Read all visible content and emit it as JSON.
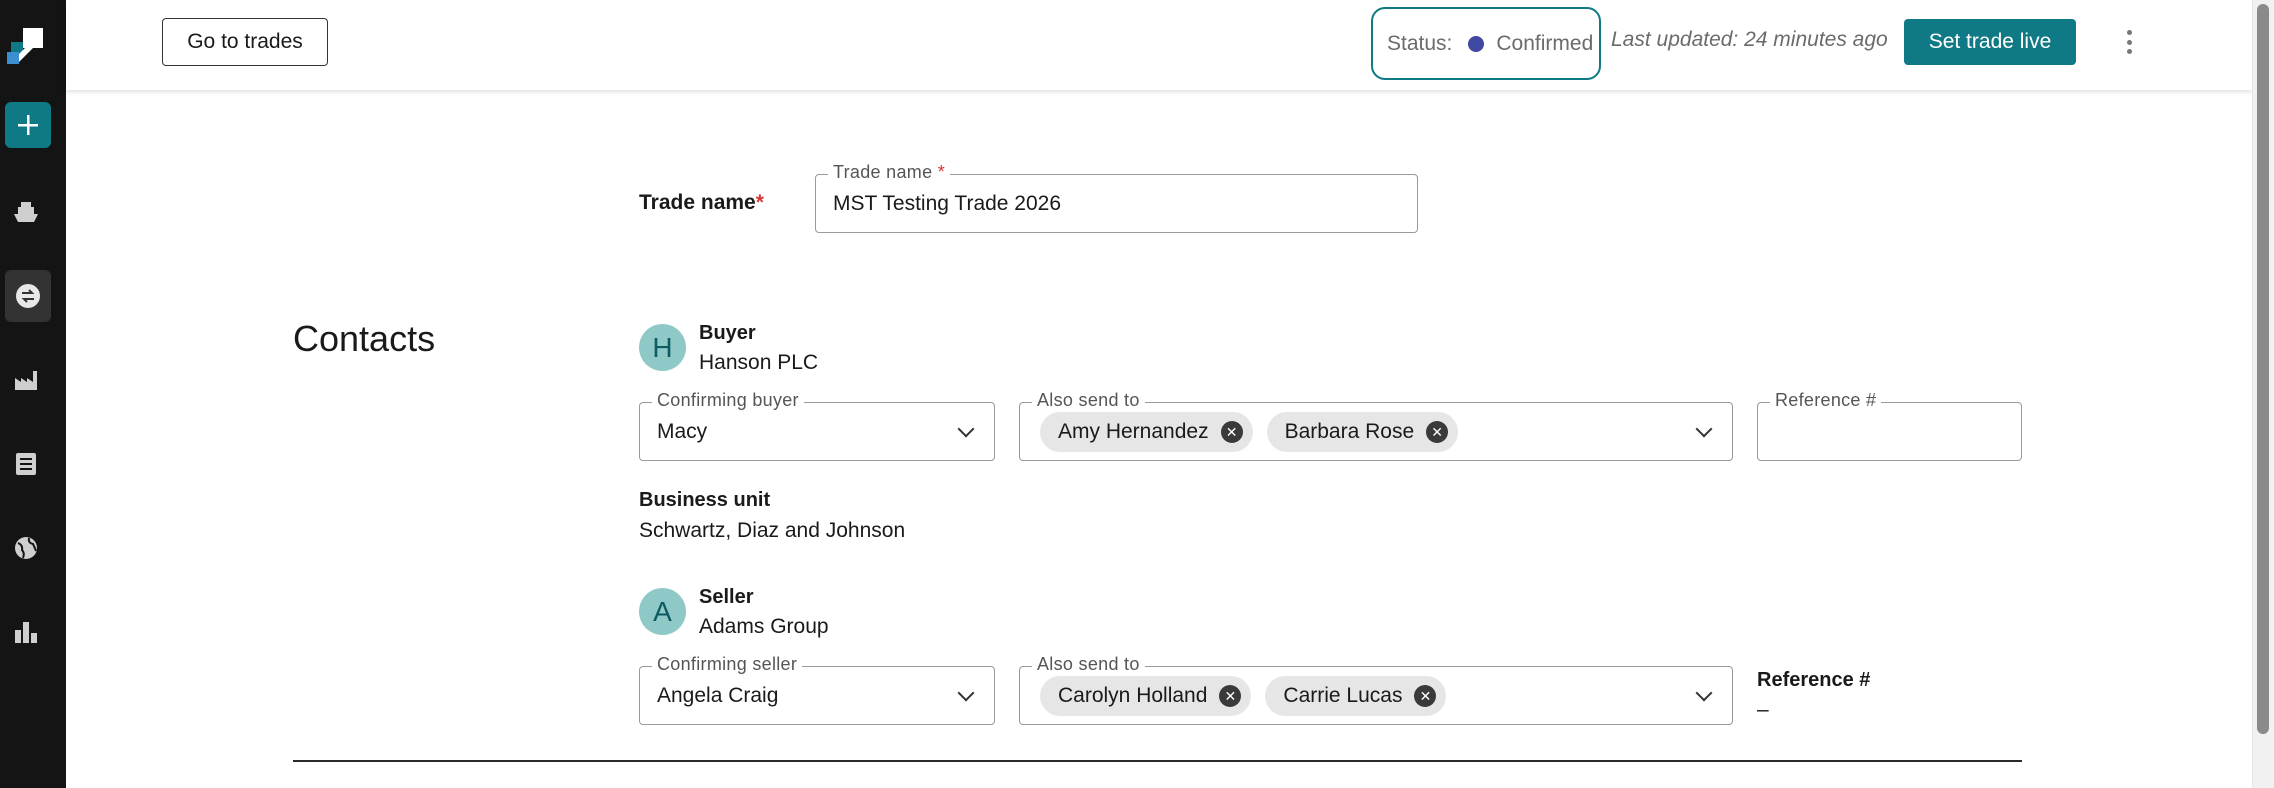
{
  "header": {
    "go_to_trades_label": "Go to trades",
    "status_label": "Status:",
    "status_value": "Confirmed",
    "status_color": "#3f4aa0",
    "last_updated": "Last updated: 24 minutes ago",
    "set_live_label": "Set trade live",
    "more_icon": "kebab-menu-icon"
  },
  "sidebar": {
    "add_icon": "plus-icon",
    "items": [
      {
        "icon": "ship-icon",
        "active": false
      },
      {
        "icon": "trade-exchange-icon",
        "active": true
      },
      {
        "icon": "factory-icon",
        "active": false
      },
      {
        "icon": "document-list-icon",
        "active": false
      },
      {
        "icon": "globe-icon",
        "active": false
      },
      {
        "icon": "bar-chart-icon",
        "active": false
      }
    ]
  },
  "trade": {
    "label": "Trade name",
    "required_mark": "*",
    "field_legend": "Trade name",
    "value": "MST Testing Trade 2026"
  },
  "contacts": {
    "title": "Contacts",
    "buyer": {
      "avatar_letter": "H",
      "role": "Buyer",
      "company": "Hanson PLC",
      "confirming_legend": "Confirming buyer",
      "confirming_value": "Macy",
      "also_send_legend": "Also send to",
      "also_send": [
        "Amy Hernandez",
        "Barbara Rose"
      ],
      "reference_legend": "Reference #",
      "reference_value": "",
      "business_unit_label": "Business unit",
      "business_unit_value": "Schwartz, Diaz and Johnson"
    },
    "seller": {
      "avatar_letter": "A",
      "role": "Seller",
      "company": "Adams Group",
      "confirming_legend": "Confirming seller",
      "confirming_value": "Angela Craig",
      "also_send_legend": "Also send to",
      "also_send": [
        "Carolyn Holland",
        "Carrie Lucas"
      ],
      "reference_label": "Reference #",
      "reference_value": "–"
    }
  },
  "colors": {
    "accent": "#0f7a85",
    "sidebar_bg": "#141414",
    "avatar_bg": "#8ec9c8"
  }
}
